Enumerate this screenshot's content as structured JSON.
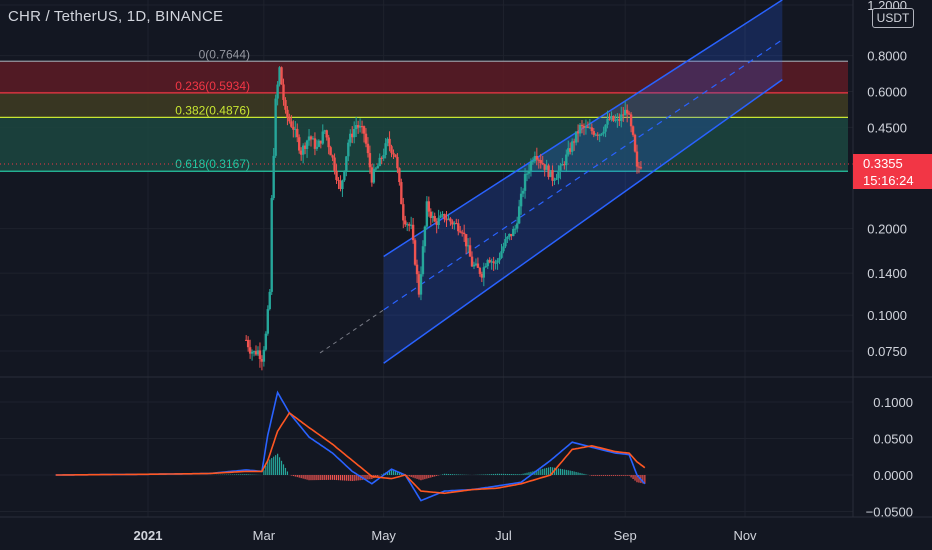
{
  "header": {
    "title": "CHR / TetherUS, 1D, BINANCE",
    "currency_badge": "USDT"
  },
  "price_tag": {
    "price": "0.3355",
    "timer": "15:16:24"
  },
  "colors": {
    "background": "#131722",
    "grid": "#1e222d",
    "axis_text": "#d1d4dc",
    "up_candle": "#26a69a",
    "down_candle": "#ef5350",
    "macd_line": "#2962ff",
    "signal_line": "#ff5722",
    "channel": "#2962ff",
    "last_price": "#f23645"
  },
  "chart_data": [
    {
      "type": "candlestick",
      "title": "CHR / TetherUS, 1D, BINANCE",
      "scale": "log",
      "ylim": [
        0.065,
        1.2
      ],
      "y_ticks": [
        "1.2000",
        "0.8000",
        "0.6000",
        "0.4500",
        "0.3355",
        "0.2000",
        "0.1400",
        "0.1000",
        "0.0750"
      ],
      "x_ticks": [
        "2021",
        "Mar",
        "May",
        "Jul",
        "Sep",
        "Nov"
      ],
      "last_price": 0.3355,
      "fibonacci": [
        {
          "label": "0(0.7644)",
          "level": 0,
          "price": 0.7644,
          "color": "#9598a1",
          "fill": "#5d1b24"
        },
        {
          "label": "0.236(0.5934)",
          "level": 0.236,
          "price": 0.5934,
          "color": "#f23645",
          "fill": "#3f3c22"
        },
        {
          "label": "0.382(0.4876)",
          "level": 0.382,
          "price": 0.4876,
          "color": "#c8e632",
          "fill": "#1c4640"
        },
        {
          "label": "0.618(0.3167)",
          "level": 0.618,
          "price": 0.3167,
          "color": "#26c6a2",
          "fill": null
        }
      ],
      "channel": {
        "upper": [
          [
            "2021-05-01",
            0.16
          ],
          [
            "2021-11-20",
            1.25
          ]
        ],
        "lower": [
          [
            "2021-05-01",
            0.068
          ],
          [
            "2021-11-20",
            0.66
          ]
        ]
      },
      "series": [
        {
          "name": "CHR/USDT",
          "dates": [
            "2021-02-20",
            "2021-02-22",
            "2021-02-24",
            "2021-02-26",
            "2021-02-28",
            "2021-03-02",
            "2021-03-04",
            "2021-03-05",
            "2021-03-07",
            "2021-03-09",
            "2021-03-12",
            "2021-03-16",
            "2021-03-20",
            "2021-03-24",
            "2021-03-28",
            "2021-04-01",
            "2021-04-05",
            "2021-04-09",
            "2021-04-13",
            "2021-04-17",
            "2021-04-21",
            "2021-04-25",
            "2021-04-29",
            "2021-05-03",
            "2021-05-07",
            "2021-05-11",
            "2021-05-15",
            "2021-05-19",
            "2021-05-23",
            "2021-05-27",
            "2021-06-01",
            "2021-06-05",
            "2021-06-10",
            "2021-06-15",
            "2021-06-20",
            "2021-06-23",
            "2021-06-27",
            "2021-07-02",
            "2021-07-07",
            "2021-07-12",
            "2021-07-17",
            "2021-07-22",
            "2021-07-26",
            "2021-07-30",
            "2021-08-04",
            "2021-08-09",
            "2021-08-14",
            "2021-08-19",
            "2021-08-24",
            "2021-08-28",
            "2021-09-02",
            "2021-09-05",
            "2021-09-07",
            "2021-09-09"
          ],
          "close": [
            0.082,
            0.076,
            0.074,
            0.075,
            0.071,
            0.085,
            0.12,
            0.25,
            0.55,
            0.72,
            0.5,
            0.45,
            0.37,
            0.42,
            0.38,
            0.44,
            0.35,
            0.27,
            0.4,
            0.46,
            0.43,
            0.3,
            0.34,
            0.4,
            0.36,
            0.22,
            0.2,
            0.12,
            0.24,
            0.21,
            0.22,
            0.21,
            0.2,
            0.15,
            0.14,
            0.16,
            0.15,
            0.18,
            0.2,
            0.3,
            0.37,
            0.33,
            0.3,
            0.32,
            0.38,
            0.45,
            0.44,
            0.43,
            0.48,
            0.47,
            0.52,
            0.41,
            0.32,
            0.3355
          ]
        }
      ]
    },
    {
      "type": "line",
      "title": "",
      "ylim": [
        -0.065,
        0.115
      ],
      "y_ticks": [
        "0.1000",
        "0.0500",
        "0.0000",
        "−0.0500"
      ],
      "series": [
        {
          "name": "",
          "color": "#2962ff",
          "dates": [
            "2020-11-15",
            "2021-01-01",
            "2021-02-01",
            "2021-02-20",
            "2021-02-28",
            "2021-03-03",
            "2021-03-08",
            "2021-03-14",
            "2021-03-24",
            "2021-04-05",
            "2021-04-15",
            "2021-04-25",
            "2021-05-05",
            "2021-05-12",
            "2021-05-20",
            "2021-06-01",
            "2021-06-15",
            "2021-06-28",
            "2021-07-10",
            "2021-07-25",
            "2021-08-05",
            "2021-08-15",
            "2021-08-27",
            "2021-09-03",
            "2021-09-07",
            "2021-09-11"
          ],
          "values": [
            0.0,
            0.001,
            0.002,
            0.007,
            0.005,
            0.055,
            0.113,
            0.085,
            0.052,
            0.03,
            0.005,
            -0.012,
            0.008,
            0.0,
            -0.035,
            -0.022,
            -0.02,
            -0.015,
            -0.01,
            0.02,
            0.045,
            0.038,
            0.03,
            0.028,
            0.0,
            -0.012
          ]
        },
        {
          "name": "",
          "color": "#ff5722",
          "dates": [
            "2020-11-15",
            "2021-01-01",
            "2021-02-01",
            "2021-02-20",
            "2021-02-28",
            "2021-03-03",
            "2021-03-08",
            "2021-03-14",
            "2021-03-24",
            "2021-04-05",
            "2021-04-15",
            "2021-04-25",
            "2021-05-05",
            "2021-05-12",
            "2021-05-20",
            "2021-06-01",
            "2021-06-15",
            "2021-06-28",
            "2021-07-10",
            "2021-07-25",
            "2021-08-05",
            "2021-08-15",
            "2021-08-27",
            "2021-09-03",
            "2021-09-07",
            "2021-09-11"
          ],
          "values": [
            0.0,
            0.001,
            0.002,
            0.005,
            0.005,
            0.02,
            0.06,
            0.085,
            0.065,
            0.042,
            0.02,
            -0.002,
            -0.005,
            0.0,
            -0.022,
            -0.025,
            -0.02,
            -0.018,
            -0.012,
            0.0,
            0.035,
            0.04,
            0.032,
            0.03,
            0.018,
            0.01
          ]
        }
      ]
    }
  ]
}
